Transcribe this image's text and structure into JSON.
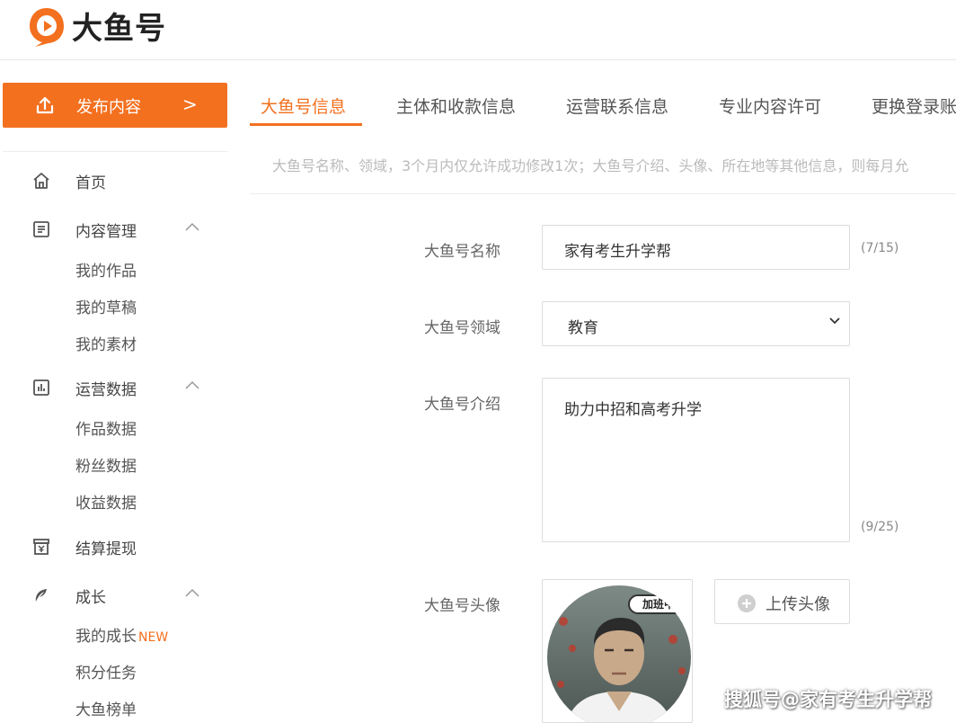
{
  "header": {
    "logo_text": "大鱼号",
    "brand_color": "#f3701f"
  },
  "sidebar": {
    "publish_label": "发布内容",
    "publish_arrow": ">",
    "items": [
      {
        "label": "首页",
        "icon": "home-icon"
      },
      {
        "label": "内容管理",
        "icon": "content-icon",
        "children": [
          "我的作品",
          "我的草稿",
          "我的素材"
        ]
      },
      {
        "label": "运营数据",
        "icon": "data-icon",
        "children": [
          "作品数据",
          "粉丝数据",
          "收益数据"
        ]
      },
      {
        "label": "结算提现",
        "icon": "settlement-icon"
      },
      {
        "label": "成长",
        "icon": "growth-icon",
        "children": [
          "我的成长",
          "积分任务",
          "大鱼榜单"
        ]
      }
    ],
    "new_badge": "NEW"
  },
  "tabs": [
    {
      "label": "大鱼号信息",
      "active": true
    },
    {
      "label": "主体和收款信息",
      "active": false
    },
    {
      "label": "运营联系信息",
      "active": false
    },
    {
      "label": "专业内容许可",
      "active": false
    },
    {
      "label": "更换登录账",
      "active": false
    }
  ],
  "notice": "大鱼号名称、领域，3个月内仅允许成功修改1次；大鱼号介绍、头像、所在地等其他信息，则每月允",
  "form": {
    "name_label": "大鱼号名称",
    "name_value": "家有考生升学帮",
    "name_counter": "(7/15)",
    "field_label": "大鱼号领域",
    "field_value": "教育",
    "intro_label": "大鱼号介绍",
    "intro_value": "助力中招和高考升学",
    "intro_counter": "(9/25)",
    "avatar_label": "大鱼号头像",
    "avatar_badge": "加班中",
    "upload_label": "上传头像"
  },
  "watermark": "搜狐号@家有考生升学帮"
}
